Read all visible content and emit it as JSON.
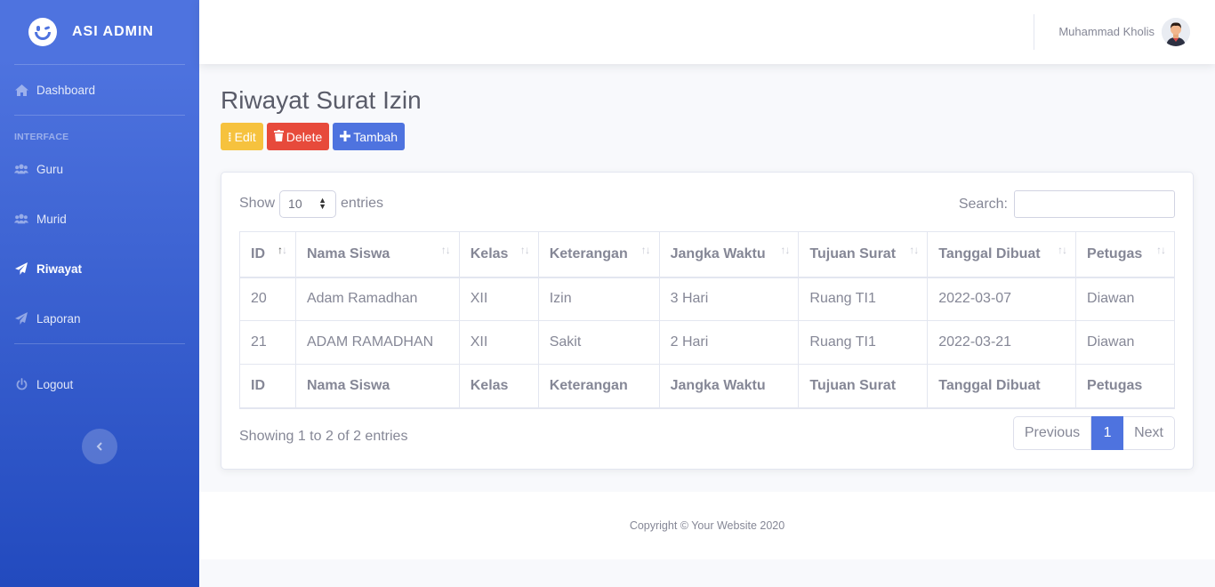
{
  "brand": {
    "name": "ASI ADMIN",
    "icon": "laugh-wink-icon"
  },
  "sidebar": {
    "dashboard": {
      "label": "Dashboard",
      "icon": "home-icon"
    },
    "heading": "INTERFACE",
    "items": [
      {
        "label": "Guru",
        "icon": "users-icon"
      },
      {
        "label": "Murid",
        "icon": "users-icon"
      },
      {
        "label": "Riwayat",
        "icon": "paper-plane-icon",
        "active": true
      },
      {
        "label": "Laporan",
        "icon": "paper-plane-icon"
      }
    ],
    "logout": {
      "label": "Logout",
      "icon": "power-icon"
    },
    "toggle_icon": "chevron-left-icon"
  },
  "topbar": {
    "user_name": "Muhammad Kholis"
  },
  "page": {
    "title": "Riwayat Surat Izin",
    "buttons": {
      "edit": "Edit",
      "delete": "Delete",
      "add": "Tambah"
    }
  },
  "datatable": {
    "show_label": "Show",
    "entries_label": "entries",
    "page_length": "10",
    "search_label": "Search:",
    "search_value": "",
    "columns": [
      "ID",
      "Nama Siswa",
      "Kelas",
      "Keterangan",
      "Jangka Waktu",
      "Tujuan Surat",
      "Tanggal Dibuat",
      "Petugas"
    ],
    "rows": [
      [
        "20",
        "Adam Ramadhan",
        "XII",
        "Izin",
        "3 Hari",
        "Ruang TI1",
        "2022-03-07",
        "Diawan"
      ],
      [
        "21",
        "ADAM RAMADHAN",
        "XII",
        "Sakit",
        "2 Hari",
        "Ruang TI1",
        "2022-03-21",
        "Diawan"
      ]
    ],
    "info": "Showing 1 to 2 of 2 entries",
    "pagination": {
      "previous": "Previous",
      "current": "1",
      "next": "Next"
    }
  },
  "footer": {
    "text": "Copyright © Your Website 2020"
  },
  "colors": {
    "primary": "#4e73df",
    "warning": "#f6c23e",
    "danger": "#e74a3b",
    "text": "#858796"
  }
}
